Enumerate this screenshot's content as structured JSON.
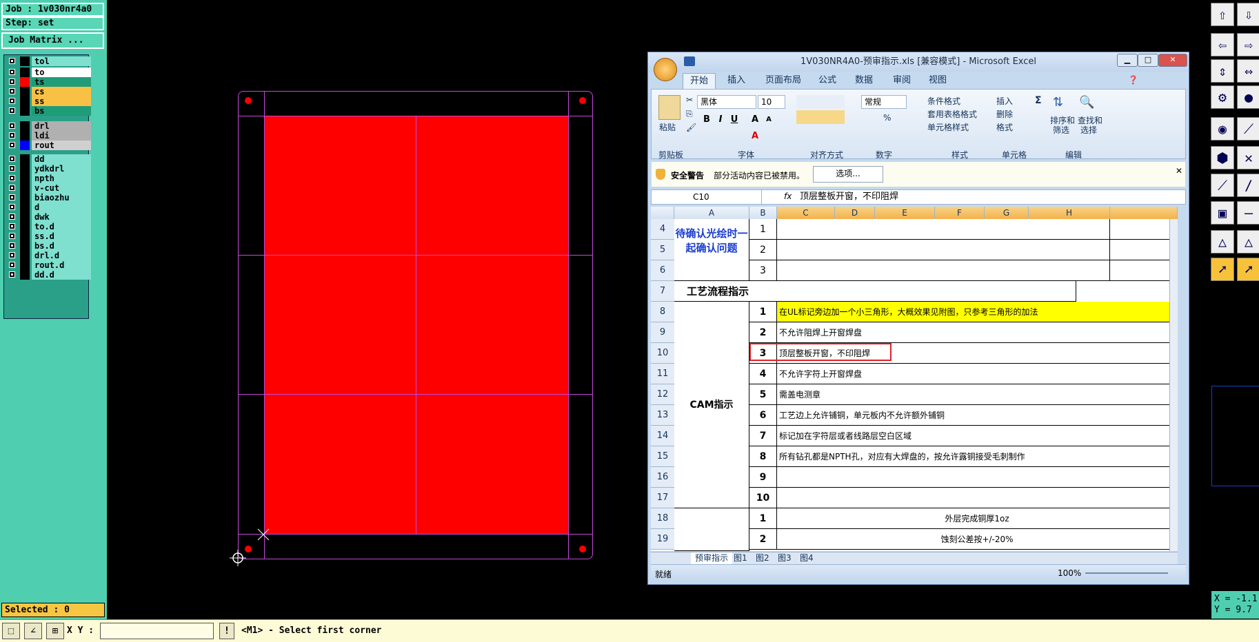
{
  "job": {
    "label": "Job : 1v030nr4a0",
    "step": "Step: set",
    "matrix_button": "Job Matrix ..."
  },
  "layers": [
    {
      "name": "tol",
      "color": "#7fe0d0",
      "swatch": "#000000"
    },
    {
      "name": "to",
      "color": "#ffffff",
      "swatch": "#000000"
    },
    {
      "name": "ts",
      "color": "#1f9c78",
      "swatch": "#ff0000"
    },
    {
      "name": "cs",
      "color": "#f8c145",
      "swatch": "#000000"
    },
    {
      "name": "ss",
      "color": "#f8c145",
      "swatch": "#000000"
    },
    {
      "name": "bs",
      "color": "#1f9c78",
      "swatch": "#000000"
    },
    {
      "name": "drl",
      "color": "#b0b0b0",
      "swatch": "#000000"
    },
    {
      "name": "ldi",
      "color": "#b0b0b0",
      "swatch": "#000000"
    },
    {
      "name": "rout",
      "color": "#d0d0d0",
      "swatch": "#0000ff"
    },
    {
      "name": "dd",
      "color": "#7fe0d0",
      "swatch": "#000000"
    },
    {
      "name": "ydkdrl",
      "color": "#7fe0d0",
      "swatch": "#000000"
    },
    {
      "name": "npth",
      "color": "#7fe0d0",
      "swatch": "#000000"
    },
    {
      "name": "v-cut",
      "color": "#7fe0d0",
      "swatch": "#000000"
    },
    {
      "name": "biaozhu",
      "color": "#7fe0d0",
      "swatch": "#000000"
    },
    {
      "name": "d",
      "color": "#7fe0d0",
      "swatch": "#000000"
    },
    {
      "name": "dwk",
      "color": "#7fe0d0",
      "swatch": "#000000"
    },
    {
      "name": "to.d",
      "color": "#7fe0d0",
      "swatch": "#000000"
    },
    {
      "name": "ss.d",
      "color": "#7fe0d0",
      "swatch": "#000000"
    },
    {
      "name": "bs.d",
      "color": "#7fe0d0",
      "swatch": "#000000"
    },
    {
      "name": "drl.d",
      "color": "#7fe0d0",
      "swatch": "#000000"
    },
    {
      "name": "rout.d",
      "color": "#7fe0d0",
      "swatch": "#000000"
    },
    {
      "name": "dd.d",
      "color": "#7fe0d0",
      "swatch": "#000000"
    }
  ],
  "selected": "Selected : 0",
  "bottom": {
    "xy_label": "X Y :",
    "xy_value": "",
    "prompt": "<M1> - Select first corner"
  },
  "coords": {
    "x": "X = -1.1",
    "y": "Y = 9.7"
  },
  "excel": {
    "title": "1V030NR4A0-预审指示.xls  [兼容模式] - Microsoft Excel",
    "tabs": [
      "开始",
      "插入",
      "页面布局",
      "公式",
      "数据",
      "审阅",
      "视图"
    ],
    "font_name": "黑体",
    "font_size": "10",
    "number_format": "常规",
    "groups": [
      "剪贴板",
      "字体",
      "对齐方式",
      "数字",
      "样式",
      "单元格",
      "编辑"
    ],
    "paste": "粘贴",
    "style_items": [
      "条件格式",
      "套用表格格式",
      "单元格样式"
    ],
    "cell_items": [
      "插入",
      "删除",
      "格式"
    ],
    "edit_items": [
      "排序和",
      "筛选",
      "查找和",
      "选择"
    ],
    "security_title": "安全警告",
    "security_text": "部分活动内容已被禁用。",
    "security_button": "选项...",
    "name_box": "C10",
    "formula": "顶层整板开窗，不印阻焊",
    "columns": [
      "A",
      "B",
      "C",
      "D",
      "E",
      "F",
      "G",
      "H"
    ],
    "row_numbers": [
      "4",
      "5",
      "6",
      "7",
      "8",
      "9",
      "10",
      "11",
      "12",
      "13",
      "14",
      "15",
      "16",
      "17",
      "18",
      "19"
    ],
    "pending_label": "待确认光绘时一起确认问题",
    "pending_nums": [
      "1",
      "2",
      "3"
    ],
    "process_label": "工艺流程指示",
    "cam_label": "CAM指示",
    "cam_items": [
      {
        "n": "1",
        "t": "在UL标记旁边加一个小三角形，大概效果见附图，只参考三角形的加法"
      },
      {
        "n": "2",
        "t": "不允许阻焊上开窗焊盘"
      },
      {
        "n": "3",
        "t": "顶层整板开窗，不印阻焊"
      },
      {
        "n": "4",
        "t": "不允许字符上开窗焊盘"
      },
      {
        "n": "5",
        "t": "需盖电测章"
      },
      {
        "n": "6",
        "t": "工艺边上允许铺铜，单元板内不允许额外铺铜"
      },
      {
        "n": "7",
        "t": "标记加在字符层或者线路层空白区域"
      },
      {
        "n": "8",
        "t": "所有钻孔都是NPTH孔，对应有大焊盘的，按允许露铜接受毛刺制作"
      },
      {
        "n": "9",
        "t": ""
      },
      {
        "n": "10",
        "t": ""
      }
    ],
    "pre_items": [
      {
        "n": "1",
        "t": "外层完成铜厚1oz"
      },
      {
        "n": "2",
        "t": "蚀刻公差按+/-20%"
      }
    ],
    "sheet_tabs": [
      "预审指示",
      "图1",
      "图2",
      "图3",
      "图4"
    ],
    "status": "就绪",
    "zoom": "100%"
  }
}
